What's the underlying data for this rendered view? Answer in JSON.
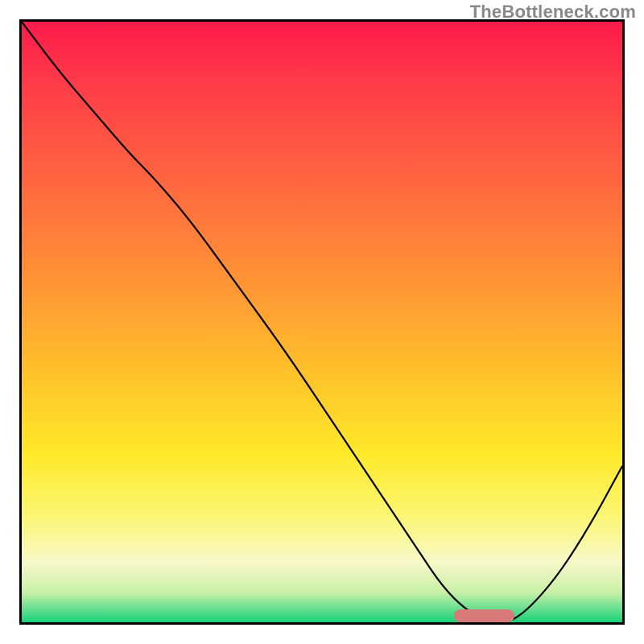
{
  "watermark": {
    "text": "TheBottleneck.com"
  },
  "chart_data": {
    "type": "line",
    "title": "",
    "xlabel": "",
    "ylabel": "",
    "xlim": [
      0,
      100
    ],
    "ylim": [
      0,
      100
    ],
    "grid": false,
    "legend": false,
    "background_gradient": {
      "direction": "vertical",
      "stops": [
        {
          "pos": 0.0,
          "color": "#ff1a4b"
        },
        {
          "pos": 0.1,
          "color": "#ff3b49"
        },
        {
          "pos": 0.28,
          "color": "#ff6a3f"
        },
        {
          "pos": 0.45,
          "color": "#ff9934"
        },
        {
          "pos": 0.6,
          "color": "#ffc62a"
        },
        {
          "pos": 0.72,
          "color": "#ffe92a"
        },
        {
          "pos": 0.82,
          "color": "#fbf670"
        },
        {
          "pos": 0.9,
          "color": "#f8f8c8"
        },
        {
          "pos": 0.95,
          "color": "#c9f0a8"
        },
        {
          "pos": 1.0,
          "color": "#17d17a"
        }
      ]
    },
    "series": [
      {
        "name": "bottleneck-curve",
        "x": [
          0,
          6,
          12,
          18,
          22,
          28,
          36,
          44,
          52,
          60,
          66,
          70,
          74,
          78,
          82,
          88,
          94,
          100
        ],
        "y": [
          100,
          92,
          85,
          78,
          74,
          67,
          56,
          45,
          33,
          21,
          12,
          6,
          2,
          0,
          0,
          6,
          15,
          26
        ]
      }
    ],
    "annotations": [
      {
        "name": "optimal-range-marker",
        "type": "bar",
        "x_start": 72,
        "x_end": 82,
        "y": 0,
        "color": "#d87a7a"
      }
    ]
  }
}
